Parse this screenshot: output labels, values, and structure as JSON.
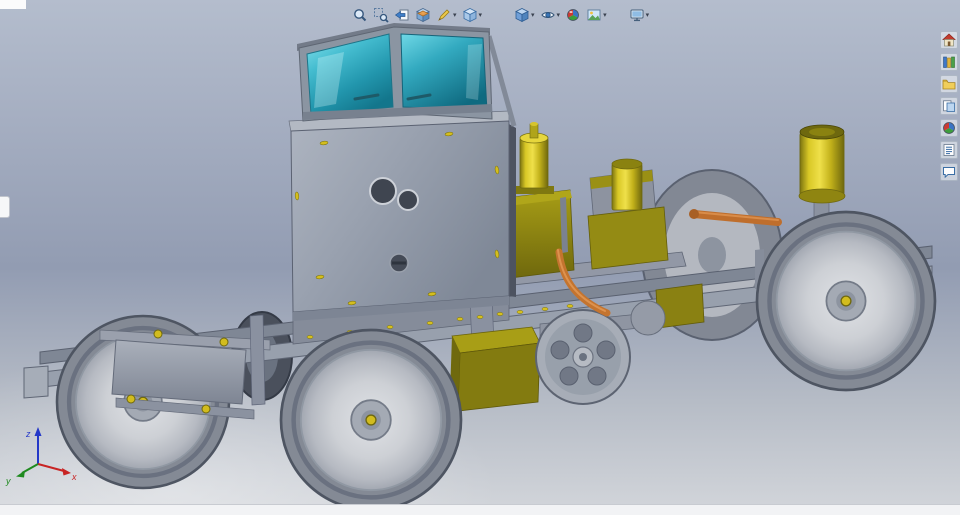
{
  "viewport": {
    "triad": {
      "x_label": "x",
      "y_label": "y",
      "z_label": "z"
    },
    "background": {
      "top": "#b4bdcd",
      "middle": "#929cb2",
      "bottom": "#d3d6db"
    },
    "model_colors": {
      "steel_gray": "#98a0ad",
      "glass_teal": "#2fa9bf",
      "brass_yellow": "#c9b81d",
      "olive_drab": "#8a8112",
      "copper": "#c4742f",
      "tire_gray": "#848a95",
      "rim_gray": "#c6c9cf"
    }
  },
  "heads_up_toolbar": {
    "dropdown_glyph": "▾",
    "icons": [
      {
        "name": "zoom-to-fit"
      },
      {
        "name": "zoom-to-area"
      },
      {
        "name": "previous-view"
      },
      {
        "name": "section-view"
      },
      {
        "name": "annotation-views",
        "dropdown": true
      },
      {
        "name": "view-orientation",
        "dropdown": true
      },
      {
        "name": "display-style",
        "dropdown": true
      },
      {
        "name": "hide-show-items",
        "dropdown": true
      },
      {
        "name": "edit-appearance"
      },
      {
        "name": "apply-scene",
        "dropdown": true
      },
      {
        "name": "view-settings",
        "dropdown": true
      }
    ]
  },
  "task_pane": {
    "tabs": [
      {
        "name": "solidworks-resources"
      },
      {
        "name": "design-library"
      },
      {
        "name": "file-explorer"
      },
      {
        "name": "view-palette"
      },
      {
        "name": "appearances-scenes"
      },
      {
        "name": "custom-properties"
      },
      {
        "name": "solidworks-forum"
      }
    ]
  },
  "status_bar": {
    "text": ""
  }
}
